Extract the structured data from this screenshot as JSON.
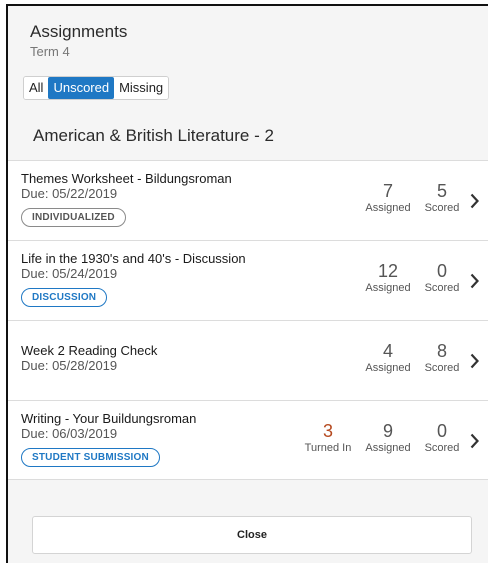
{
  "header": {
    "title": "Assignments",
    "subtitle": "Term 4"
  },
  "filters": [
    {
      "label": "All",
      "active": false
    },
    {
      "label": "Unscored",
      "active": true
    },
    {
      "label": "Missing",
      "active": false
    }
  ],
  "course": {
    "title": "American & British Literature - 2"
  },
  "assignments": [
    {
      "name": "Themes Worksheet - Bildungsroman",
      "due": "Due: 05/22/2019",
      "badge": "INDIVIDUALIZED",
      "assigned": "7",
      "assigned_label": "Assigned",
      "scored": "5",
      "scored_label": "Scored"
    },
    {
      "name": "Life in the 1930's and 40's - Discussion",
      "due": "Due: 05/24/2019",
      "badge": "DISCUSSION",
      "assigned": "12",
      "assigned_label": "Assigned",
      "scored": "0",
      "scored_label": "Scored"
    },
    {
      "name": "Week 2 Reading Check",
      "due": "Due: 05/28/2019",
      "assigned": "4",
      "assigned_label": "Assigned",
      "scored": "8",
      "scored_label": "Scored"
    },
    {
      "name": "Writing - Your Buildungsroman",
      "due": "Due: 06/03/2019",
      "badge": "STUDENT SUBMISSION",
      "turned_in": "3",
      "turned_in_label": "Turned In",
      "assigned": "9",
      "assigned_label": "Assigned",
      "scored": "0",
      "scored_label": "Scored"
    }
  ],
  "footer": {
    "close_label": "Close"
  },
  "colors": {
    "accent": "#1f78c4",
    "turned_in": "#b5491f",
    "panel_bg": "#f5f5f5"
  },
  "icons": {
    "row_arrow": "chevron-right-icon"
  }
}
